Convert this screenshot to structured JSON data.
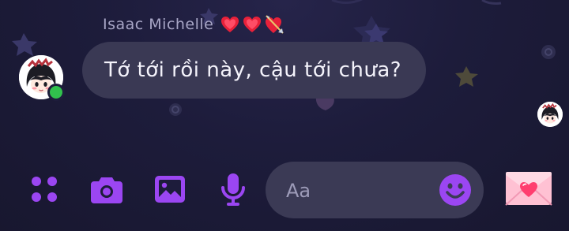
{
  "theme": {
    "accent": "#9b46f2",
    "bubble_bg": "#3a3954",
    "input_bg": "#3b3a55",
    "online": "#31c24d",
    "name_color": "#a8a6c6",
    "text_color": "#f4f3fb"
  },
  "conversation": {
    "sender_name": "Isaac Michelle",
    "sender_name_emojis": [
      "heart-exclamation-emoji",
      "heart-exclamation-emoji",
      "heart-with-arrow-emoji"
    ],
    "sender_online": true,
    "message": {
      "text": "Tớ tới rồi này, cậu tới chưa?"
    }
  },
  "composer": {
    "actions": [
      {
        "name": "more-actions",
        "icon": "four-dots-grid-icon"
      },
      {
        "name": "camera",
        "icon": "camera-icon"
      },
      {
        "name": "gallery",
        "icon": "image-icon"
      },
      {
        "name": "voice",
        "icon": "microphone-icon"
      }
    ],
    "input_placeholder": "Aa",
    "input_value": "",
    "emoji_icon": "smiley-icon",
    "quick_reaction_icon": "heart-envelope-icon"
  }
}
